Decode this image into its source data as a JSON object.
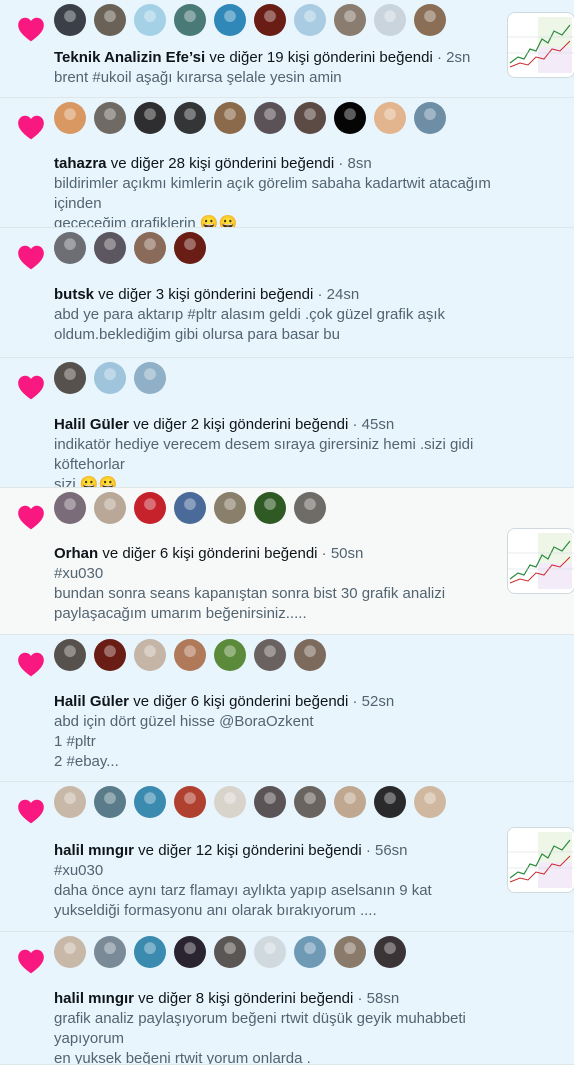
{
  "colors": {
    "unread_bg": "#e8f5fd",
    "read_bg": "#f7f9f9",
    "heart": "#f91880",
    "name": "#0f1419",
    "secondary": "#536471"
  },
  "notifications": [
    {
      "name": "Teknik Analizin Efe’si",
      "action": " ve diğer 19 kişi gönderini beğendi",
      "time": " · 2sn",
      "text": "brent #ukoil  aşağı kırarsa şelale yesin amin",
      "icon": "heart-icon",
      "state": "unread",
      "has_thumbnail": true,
      "avatar_colors": [
        "#3b3f48",
        "#6a6256",
        "#a4d1e6",
        "#4a7a78",
        "#2f88b8",
        "#6a1d14",
        "#a9cce2",
        "#8a7d70",
        "#c9d4dd",
        "#8a6f56"
      ]
    },
    {
      "name": "tahazra",
      "action": " ve diğer 28 kişi gönderini beğendi",
      "time": " · 8sn",
      "text": "bildirimler açıkmı kimlerin açık görelim sabaha kadartwit atacağım içinden\ngeçeceğim grafiklerin 😀😀",
      "icon": "heart-icon",
      "state": "unread",
      "has_thumbnail": false,
      "avatar_colors": [
        "#d99862",
        "#6f6a64",
        "#2e2e30",
        "#333537",
        "#8b6a4c",
        "#5b5258",
        "#5c4a44",
        "#050505",
        "#e2b58e",
        "#6e8ea6"
      ]
    },
    {
      "name": "butsk",
      "action": " ve diğer 3 kişi gönderini beğendi",
      "time": " · 24sn",
      "text": "abd ye para aktarıp #pltr  alasım geldi .çok güzel grafik aşık\noldum.beklediğim gibi olursa para basar bu",
      "icon": "heart-icon",
      "state": "unread",
      "has_thumbnail": false,
      "avatar_colors": [
        "#6c6e74",
        "#5c5660",
        "#8a6b5a",
        "#6a1d14"
      ]
    },
    {
      "name": "Halil Güler",
      "action": " ve diğer 2 kişi gönderini beğendi",
      "time": " · 45sn",
      "text": "indikatör hediye verecem desem sıraya girersiniz hemi .sizi gidi köftehorlar\nsizi 😀😀",
      "icon": "heart-icon",
      "state": "unread",
      "has_thumbnail": false,
      "avatar_colors": [
        "#56514c",
        "#9fc5dc",
        "#8fb0c7"
      ]
    },
    {
      "name": "Orhan",
      "action": " ve diğer 6 kişi gönderini beğendi",
      "time": " · 50sn",
      "text": "#xu030\nbundan sonra seans kapanıştan sonra bist 30 grafik analizi\npaylaşacağım umarım beğenirsiniz.....",
      "icon": "heart-icon",
      "state": "read",
      "has_thumbnail": true,
      "avatar_colors": [
        "#7a6c78",
        "#b9a898",
        "#c5222c",
        "#4a6a9a",
        "#8a7f6a",
        "#2f5a24",
        "#6f6c68"
      ]
    },
    {
      "name": "Halil Güler",
      "action": " ve diğer 6 kişi gönderini beğendi",
      "time": " · 52sn",
      "text": "abd için dört güzel hisse @BoraOzkent\n1  #pltr\n2 #ebay...",
      "icon": "heart-icon",
      "state": "unread",
      "has_thumbnail": false,
      "avatar_colors": [
        "#56514c",
        "#6a1d14",
        "#c4b5a6",
        "#b07a5a",
        "#5b8a3a",
        "#6a6260",
        "#7c6a5c"
      ]
    },
    {
      "name": "halil mıngır",
      "action": " ve diğer 12 kişi gönderini beğendi",
      "time": " · 56sn",
      "text": "#xu030\ndaha önce aynı tarz flamayı aylıkta yapıp aselsanın 9 kat\nyukseldiği formasyonu anı olarak bırakıyorum ....",
      "icon": "heart-icon",
      "state": "unread",
      "has_thumbnail": true,
      "avatar_colors": [
        "#c8b8a8",
        "#5a7c8a",
        "#3b8bb0",
        "#b04030",
        "#d8d4cc",
        "#5a5456",
        "#6a6460",
        "#c0a890",
        "#2a2a2c",
        "#d0b8a0"
      ]
    },
    {
      "name": "halil mıngır",
      "action": " ve diğer 8 kişi gönderini beğendi",
      "time": " · 58sn",
      "text": "grafik analiz paylaşıyorum beğeni rtwit düşük  geyik muhabbeti yapıyorum\nen yuksek beğeni rtwit yorum onlarda .\n...",
      "icon": "heart-icon",
      "state": "unread",
      "has_thumbnail": false,
      "avatar_colors": [
        "#c8b8a8",
        "#7a8a96",
        "#3b8bb0",
        "#2a2430",
        "#5a5654",
        "#cfd9de",
        "#6f9ab6",
        "#8a7a6a",
        "#3a3436"
      ]
    }
  ]
}
